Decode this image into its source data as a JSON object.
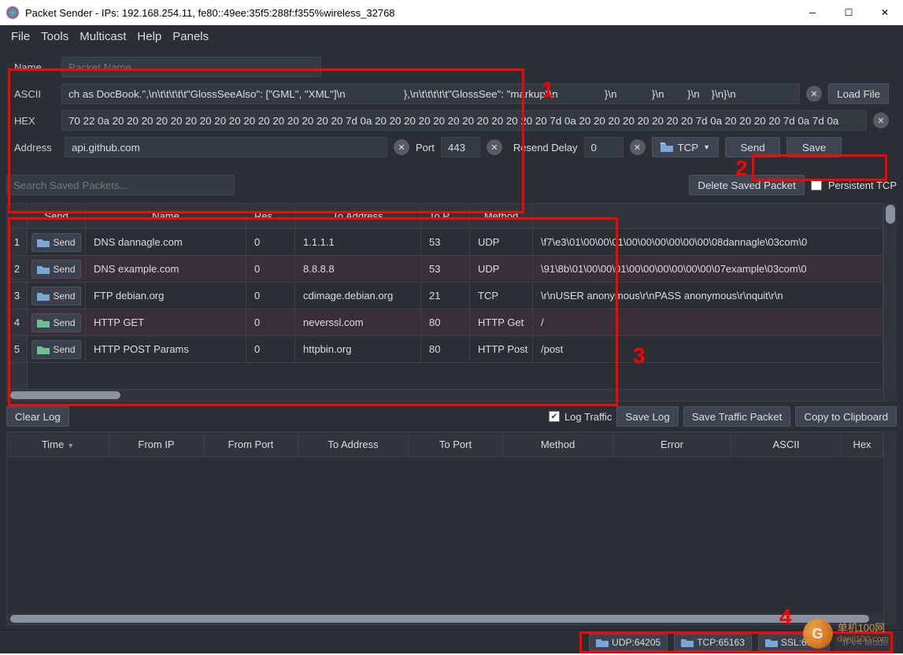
{
  "window": {
    "title": "Packet Sender - IPs: 192.168.254.11, fe80::49ee:35f5:288f:f355%wireless_32768"
  },
  "menu": {
    "file": "File",
    "tools": "Tools",
    "multicast": "Multicast",
    "help": "Help",
    "panels": "Panels"
  },
  "form": {
    "name_label": "Name",
    "name_placeholder": "Packet Name",
    "ascii_label": "ASCII",
    "ascii_value": "ch as DocBook.\",\\n\\t\\t\\t\\t\\t\"GlossSeeAlso\": [\"GML\", \"XML\"]\\n                    },\\n\\t\\t\\t\\t\\t\"GlossSee\": \"markup\"\\n                }\\n            }\\n        }\\n    }\\n}\\n",
    "hex_label": "HEX",
    "hex_value": "70 22 0a 20 20 20 20 20 20 20 20 20 20 20 20 20 20 20 20 7d 0a 20 20 20 20 20 20 20 20 20 20 20 20 7d 0a 20 20 20 20 20 20 20 20 7d 0a 20 20 20 20 7d 0a 7d 0a",
    "address_label": "Address",
    "address_value": "api.github.com",
    "port_label": "Port",
    "port_value": "443",
    "resend_label": "Resend Delay",
    "resend_value": "0",
    "protocol": "TCP",
    "load_file": "Load File",
    "send": "Send",
    "save": "Save"
  },
  "mid_toolbar": {
    "search_placeholder": "Search Saved Packets...",
    "delete": "Delete Saved Packet",
    "persistent": "Persistent TCP"
  },
  "saved_packets": {
    "headers": {
      "send": "Send",
      "name": "Name",
      "resend": "Resend",
      "to_addr": "To Address",
      "to_port": "To Port",
      "method": "Method",
      "hex": ""
    },
    "rows": [
      {
        "n": "1",
        "name": "DNS dannagle.com",
        "resend": "0",
        "addr": "1.1.1.1",
        "port": "53",
        "method": "UDP",
        "hex": "\\f7\\e3\\01\\00\\00\\01\\00\\00\\00\\00\\00\\00\\08dannagle\\03com\\0",
        "hl": false
      },
      {
        "n": "2",
        "name": "DNS example.com",
        "resend": "0",
        "addr": "8.8.8.8",
        "port": "53",
        "method": "UDP",
        "hex": "\\91\\8b\\01\\00\\00\\01\\00\\00\\00\\00\\00\\00\\07example\\03com\\0",
        "hl": true
      },
      {
        "n": "3",
        "name": "FTP debian.org",
        "resend": "0",
        "addr": "cdimage.debian.org",
        "port": "21",
        "method": "TCP",
        "hex": "\\r\\nUSER anonymous\\r\\nPASS anonymous\\r\\nquit\\r\\n",
        "hl": false
      },
      {
        "n": "4",
        "name": "HTTP GET",
        "resend": "0",
        "addr": "neverssl.com",
        "port": "80",
        "method": "HTTP Get",
        "hex": "/",
        "hl": true,
        "green": true
      },
      {
        "n": "5",
        "name": "HTTP POST Params",
        "resend": "0",
        "addr": "httpbin.org",
        "port": "80",
        "method": "HTTP Post",
        "hex": "/post",
        "hl": false,
        "green": true
      }
    ],
    "send_btn": "Send"
  },
  "log_toolbar": {
    "clear": "Clear Log",
    "log_traffic": "Log Traffic",
    "save_log": "Save Log",
    "save_traffic": "Save Traffic Packet",
    "copy": "Copy to Clipboard"
  },
  "log_headers": {
    "time": "Time",
    "from_ip": "From IP",
    "from_port": "From Port",
    "to_addr": "To Address",
    "to_port": "To Port",
    "method": "Method",
    "error": "Error",
    "ascii": "ASCII",
    "hex": "Hex"
  },
  "status": {
    "udp": "UDP:64205",
    "tcp": "TCP:65163",
    "ssl": "SSL:6516",
    "ipv4": "IPv4 Mode"
  },
  "annot": {
    "n1": "1",
    "n2": "2",
    "n3": "3",
    "n4": "4"
  },
  "watermark": {
    "cn": "单机100网",
    "url": "danji100.com"
  }
}
